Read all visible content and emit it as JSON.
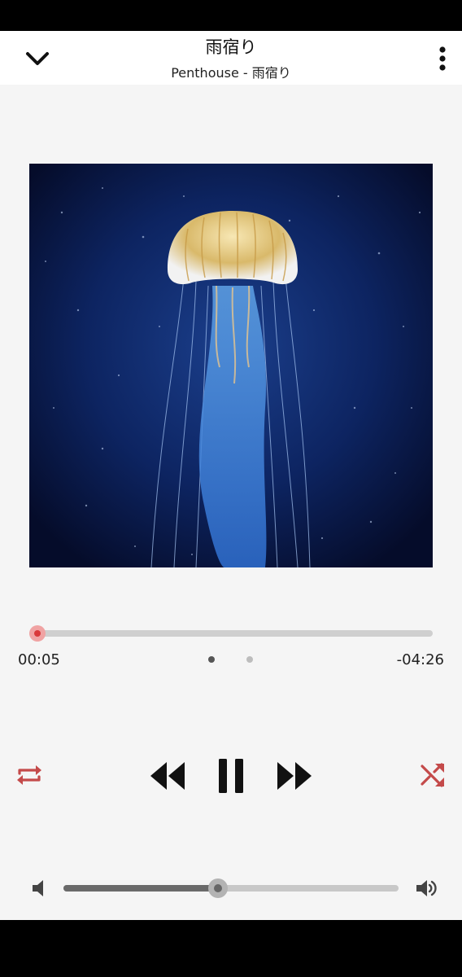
{
  "header": {
    "title": "雨宿り",
    "subtitle": "Penthouse - 雨宿り",
    "collapse_icon": "chevron-down-icon",
    "menu_icon": "more-vert-icon"
  },
  "artwork": {
    "description_icon": "jellyfish-album-art"
  },
  "playback": {
    "elapsed": "00:05",
    "remaining": "-04:26",
    "progress_fraction": 0.02,
    "page_count": 2,
    "current_page": 1
  },
  "controls": {
    "repeat_icon": "repeat-icon",
    "rewind_icon": "rewind-icon",
    "pause_icon": "pause-icon",
    "forward_icon": "fast-forward-icon",
    "shuffle_icon": "shuffle-icon"
  },
  "volume": {
    "level_fraction": 0.46,
    "mute_icon": "volume-low-icon",
    "max_icon": "volume-high-icon"
  },
  "colors": {
    "accent": "#d9393a",
    "accent_icon": "#c44a4a",
    "background": "#f5f5f5",
    "text": "#222222"
  }
}
